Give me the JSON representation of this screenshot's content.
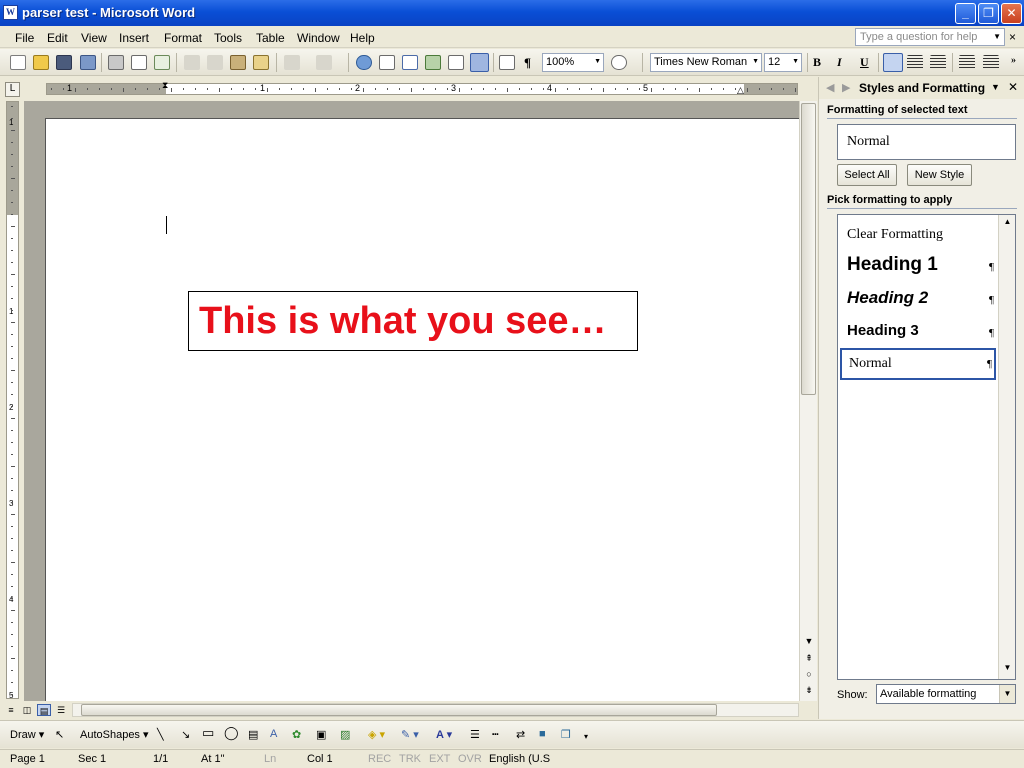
{
  "window": {
    "title": "parser  test - Microsoft Word",
    "icon_letter": "W",
    "minimize": "_",
    "maximize": "❐",
    "close": "✕"
  },
  "menu": {
    "items": [
      "File",
      "Edit",
      "View",
      "Insert",
      "Format",
      "Tools",
      "Table",
      "Window",
      "Help"
    ],
    "help_placeholder": "Type a question for help",
    "close": "×"
  },
  "toolbar": {
    "zoom": "100%",
    "font_name": "Times New Roman",
    "font_size": "12",
    "bold": "B",
    "italic": "I",
    "underline": "U",
    "pilcrow": "¶"
  },
  "ruler": {
    "tab_selector": "L",
    "marks": [
      "1",
      "1",
      "2",
      "3",
      "4",
      "5"
    ],
    "vmarks": [
      "1",
      "1",
      "2",
      "3",
      "4",
      "5"
    ]
  },
  "document": {
    "textbox_text": "This is what you see…"
  },
  "taskpane": {
    "title": "Styles and Formatting",
    "section_selected": "Formatting of selected text",
    "selected_style": "Normal",
    "select_all": "Select All",
    "new_style": "New Style",
    "section_pick": "Pick formatting to apply",
    "styles": [
      {
        "label": "Clear Formatting",
        "para": ""
      },
      {
        "label": "Heading 1",
        "para": "¶"
      },
      {
        "label": "Heading 2",
        "para": "¶"
      },
      {
        "label": "Heading 3",
        "para": "¶"
      },
      {
        "label": "Normal",
        "para": "¶"
      }
    ],
    "show_label": "Show:",
    "show_value": "Available formatting"
  },
  "drawbar": {
    "draw": "Draw",
    "autoshapes": "AutoShapes"
  },
  "status": {
    "page": "Page  1",
    "sec": "Sec  1",
    "pages": "1/1",
    "at": "At  1\"",
    "ln": "Ln",
    "col": "Col  1",
    "rec": "REC",
    "trk": "TRK",
    "ext": "EXT",
    "ovr": "OVR",
    "language": "English (U.S"
  },
  "colors": {
    "title_bar": "#0a4fd6",
    "textbox_text": "#e8101a",
    "selection_border": "#2c55a6"
  }
}
